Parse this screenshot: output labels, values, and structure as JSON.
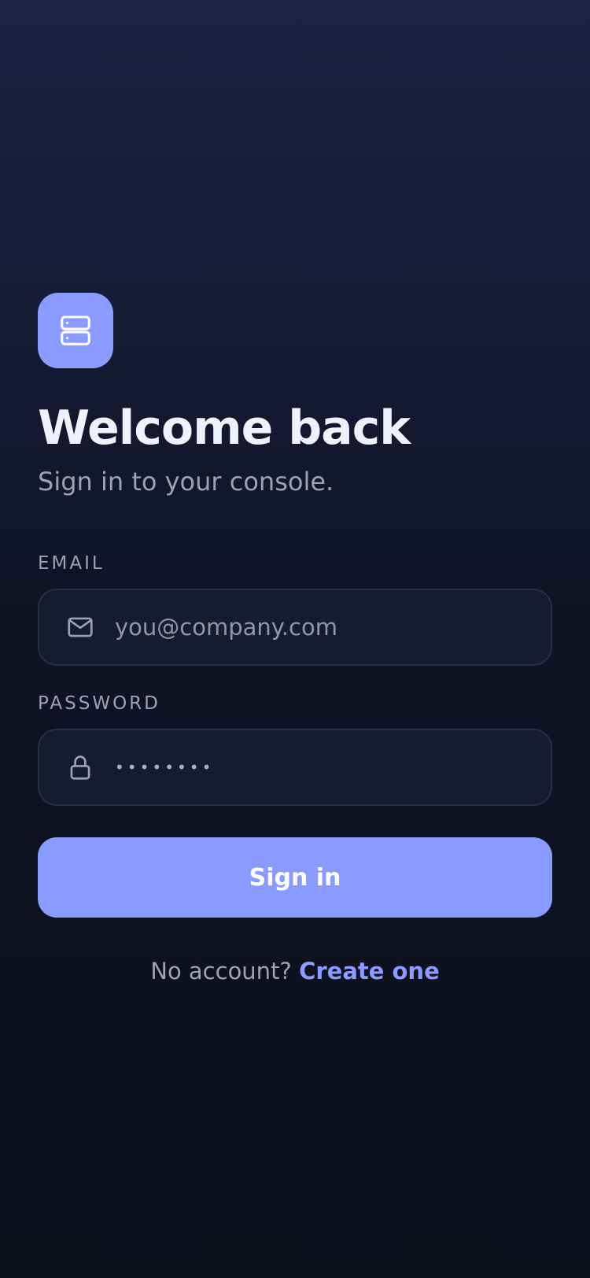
{
  "brand": {
    "logo_icon": "server-icon",
    "accent_color": "#8b9bff"
  },
  "header": {
    "title": "Welcome back",
    "subtitle": "Sign in to your console."
  },
  "form": {
    "email": {
      "label": "EMAIL",
      "icon": "mail-icon",
      "placeholder": "you@company.com",
      "value": ""
    },
    "password": {
      "label": "PASSWORD",
      "icon": "lock-icon",
      "value": "••••••••"
    },
    "submit_label": "Sign in"
  },
  "footer": {
    "prompt": "No account?",
    "link_label": "Create one"
  }
}
